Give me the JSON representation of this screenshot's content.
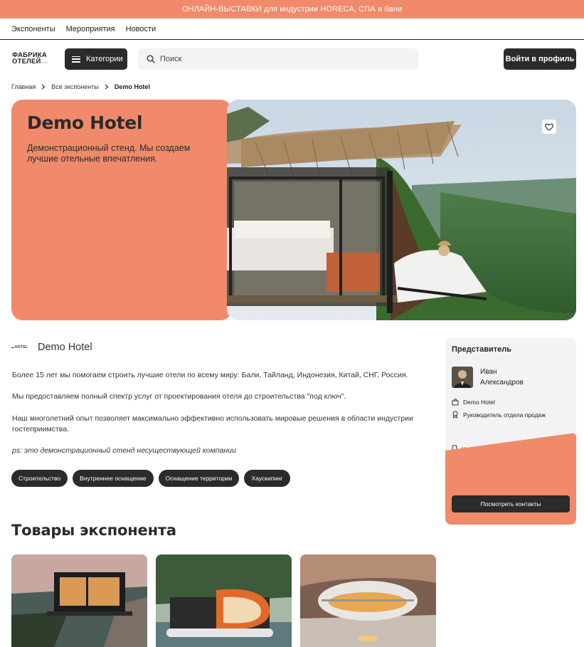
{
  "banner": {
    "text": "ОНЛАЙН-ВЫСТАВКИ для индустрии HORECA, СПА и бани"
  },
  "subnav": {
    "items": [
      "Экспоненты",
      "Мероприятия",
      "Новости"
    ]
  },
  "header": {
    "logo_line1": "ФАБРИКА",
    "logo_line2": "ОТЕЛЕЙ",
    "logo_tagline": "hotel",
    "categories_label": "Категории",
    "search_placeholder": "Поиск",
    "login_label": "Войти в профиль"
  },
  "breadcrumbs": {
    "home": "Главная",
    "exhibitors": "Все экспоненты",
    "current": "Demo Hotel"
  },
  "hero": {
    "title": "Demo Hotel",
    "description": "Демонстрационный стенд. Мы создаем лучшие отельные впечатления."
  },
  "company": {
    "logo_text": "HOTEL",
    "name": "Demo Hotel",
    "paragraphs": [
      "Более 15 лет мы помогаем строить лучшие отели по всему миру: Бали, Тайланд, Индонезия, Китай, СНГ, Россия.",
      "Мы предоставляем полный спектр услуг от проектирования отеля до строительства \"под ключ\".",
      "Наш многолетний опыт позволяет максимально эффективно использовать мировые решения в области индустрии гостеприимства."
    ],
    "ps": "ps: это демонстрационный стенд несуществующей компании",
    "tags": [
      "Строительство",
      "Внутреннее оснащение",
      "Оснащение территории",
      "Хаускипинг"
    ]
  },
  "representative": {
    "title": "Представитель",
    "first_name": "Иван",
    "last_name": "Александров",
    "company": "Demo Hotel",
    "position": "Руководитель отдела продаж",
    "phone_partial": "Не ука",
    "contacts_button": "Посмотреть контакты"
  },
  "goods": {
    "title": "Товары экспонента"
  },
  "colors": {
    "accent": "#f08a6a",
    "dark": "#2b2b2b",
    "card_bg": "#f3f3f3"
  },
  "icons": [
    "burger-icon",
    "search-icon",
    "chevron-right-icon",
    "heart-icon",
    "building-icon",
    "badge-icon",
    "phone-icon"
  ]
}
